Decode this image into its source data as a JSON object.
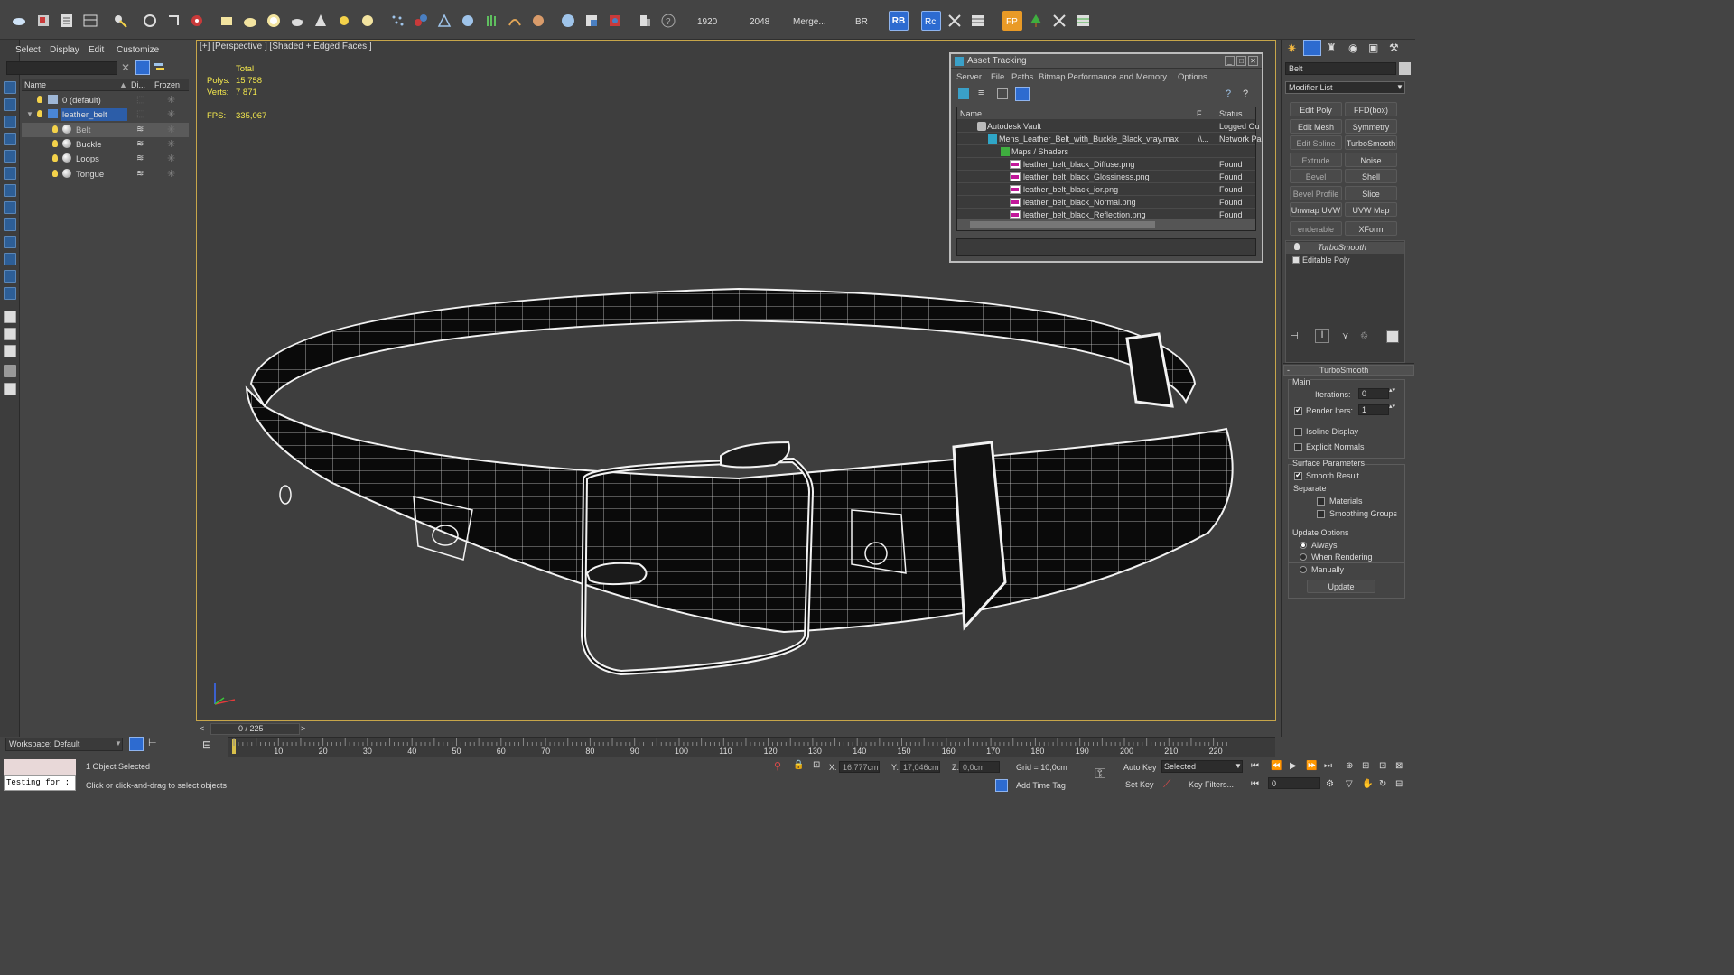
{
  "toolbar": {
    "render_width": "1920",
    "render_height": "2048",
    "merge_label": "Merge...",
    "br_label": "BR",
    "rb_label": "RB"
  },
  "explorer": {
    "menus": [
      "Select",
      "Display",
      "Edit",
      "Customize"
    ],
    "columns": {
      "name": "Name",
      "display": "Di...",
      "frozen": "Frozen"
    },
    "rows": [
      {
        "label": "0 (default)"
      },
      {
        "label": "leather_belt"
      },
      {
        "label": "Belt"
      },
      {
        "label": "Buckle"
      },
      {
        "label": "Loops"
      },
      {
        "label": "Tongue"
      }
    ],
    "workspace": "Workspace: Default"
  },
  "viewport": {
    "label": "[+] [Perspective ] [Shaded + Edged Faces ]",
    "stats_total": "Total",
    "polys_label": "Polys:",
    "polys_value": "15 758",
    "verts_label": "Verts:",
    "verts_value": "7 871",
    "fps_label": "FPS:",
    "fps_value": "335,067"
  },
  "asset_tracking": {
    "title": "Asset Tracking",
    "menus": [
      "Server",
      "File",
      "Paths",
      "Bitmap Performance and Memory",
      "Options"
    ],
    "columns": {
      "name": "Name",
      "full": "F...",
      "status": "Status"
    },
    "rows": [
      {
        "name": "Autodesk Vault",
        "path": "",
        "status": "Logged Ou"
      },
      {
        "name": "Mens_Leather_Belt_with_Buckle_Black_vray.max",
        "path": "\\\\...",
        "status": "Network Pa"
      },
      {
        "name": "Maps / Shaders",
        "path": "",
        "status": ""
      },
      {
        "name": "leather_belt_black_Diffuse.png",
        "path": "",
        "status": "Found"
      },
      {
        "name": "leather_belt_black_Glossiness.png",
        "path": "",
        "status": "Found"
      },
      {
        "name": "leather_belt_black_ior.png",
        "path": "",
        "status": "Found"
      },
      {
        "name": "leather_belt_black_Normal.png",
        "path": "",
        "status": "Found"
      },
      {
        "name": "leather_belt_black_Reflection.png",
        "path": "",
        "status": "Found"
      }
    ]
  },
  "command_panel": {
    "object_name": "Belt",
    "modifier_list": "Modifier List",
    "buttons": [
      "Edit Poly",
      "FFD(box)",
      "Edit Mesh",
      "Symmetry",
      "Edit Spline",
      "TurboSmooth",
      "Extrude",
      "Noise",
      "Bevel",
      "Shell",
      "Bevel Profile",
      "Slice",
      "Unwrap UVW",
      "UVW Map",
      "enderable Splir",
      "XForm"
    ],
    "stack": [
      "TurboSmooth",
      "Editable Poly"
    ],
    "rollout_title": "TurboSmooth",
    "main_label": "Main",
    "iterations_label": "Iterations:",
    "iterations_value": "0",
    "render_iters_label": "Render Iters:",
    "render_iters_value": "1",
    "isoline_label": "Isoline Display",
    "explicit_normals_label": "Explicit Normals",
    "surface_params_label": "Surface Parameters",
    "smooth_result_label": "Smooth Result",
    "separate_label": "Separate",
    "materials_label": "Materials",
    "smoothing_groups_label": "Smoothing Groups",
    "update_options_label": "Update Options",
    "always_label": "Always",
    "when_rendering_label": "When Rendering",
    "manually_label": "Manually",
    "update_button": "Update"
  },
  "timeline": {
    "frame_counter": "0 / 225",
    "ticks": [
      "10",
      "20",
      "30",
      "40",
      "50",
      "60",
      "70",
      "80",
      "90",
      "100",
      "110",
      "120",
      "130",
      "140",
      "150",
      "160",
      "170",
      "180",
      "190",
      "200",
      "210",
      "220"
    ]
  },
  "status": {
    "maxscript_text": "Testing for :",
    "selection": "1 Object Selected",
    "prompt": "Click or click-and-drag to select objects",
    "x_label": "X:",
    "x_value": "16,777cm",
    "y_label": "Y:",
    "y_value": "17,046cm",
    "z_label": "Z:",
    "z_value": "0,0cm",
    "grid": "Grid = 10,0cm",
    "add_time_tag": "Add Time Tag",
    "auto_key": "Auto Key",
    "set_key": "Set Key",
    "selected": "Selected",
    "key_filters": "Key Filters...",
    "frame_value": "0"
  },
  "colors": {
    "accent": "#2d5e96",
    "selection": "#2c5da8",
    "viewport_border": "#c7a64a",
    "stats": "#f5e94d"
  }
}
